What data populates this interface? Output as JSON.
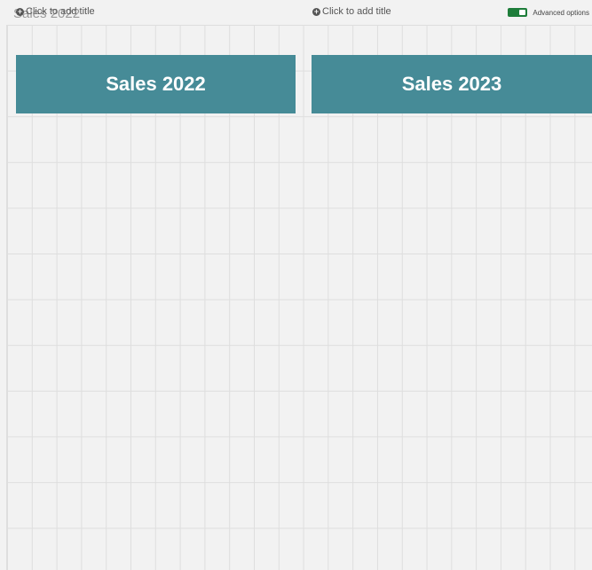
{
  "header": {
    "sheet_title": "Sales 2022",
    "advanced_options_label": "Advanced options",
    "advanced_options_enabled": true,
    "toggle_color": "#1e7d3a"
  },
  "panels": [
    {
      "add_title_label": "Click to add title",
      "kpi_text": "Sales 2022",
      "color": "#468b97"
    },
    {
      "add_title_label": "Click to add title",
      "kpi_text": "Sales 2023",
      "color": "#468b97"
    }
  ]
}
